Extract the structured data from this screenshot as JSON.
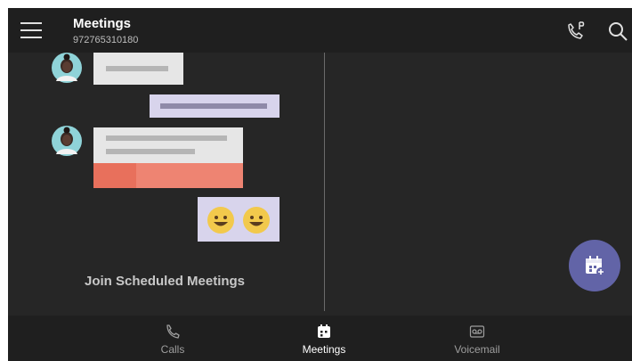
{
  "header": {
    "title": "Meetings",
    "subtitle": "972765310180"
  },
  "empty_state": {
    "label": "Join Scheduled Meetings"
  },
  "bottom_nav": {
    "items": [
      {
        "label": "Calls",
        "icon": "phone-icon",
        "active": false
      },
      {
        "label": "Meetings",
        "icon": "calendar-icon",
        "active": true
      },
      {
        "label": "Voicemail",
        "icon": "voicemail-icon",
        "active": false
      }
    ]
  },
  "colors": {
    "background": "#262626",
    "bar": "#1f1f1f",
    "accent": "#6264a7",
    "bubble_light": "#e6e6e6",
    "bubble_lavender": "#d8d4ec",
    "attachment_red": "#e8705c",
    "emoji_yellow": "#f2c94c"
  }
}
